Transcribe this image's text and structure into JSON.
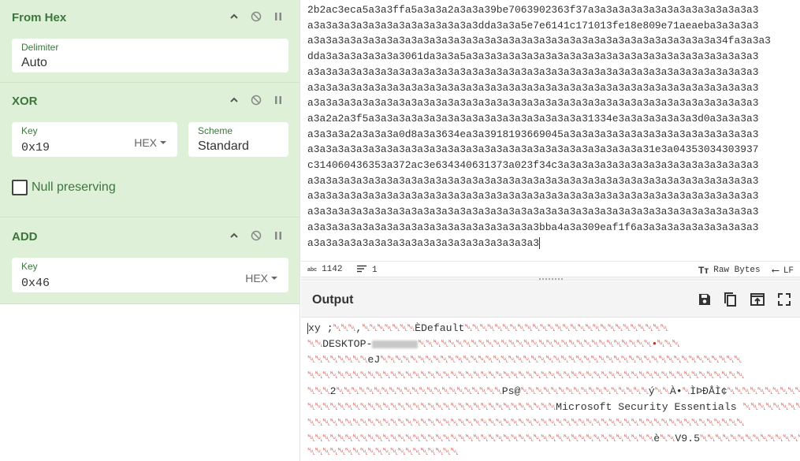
{
  "recipe": {
    "operations": [
      {
        "title": "From Hex",
        "fields": [
          {
            "label": "Delimiter",
            "value": "Auto"
          }
        ]
      },
      {
        "title": "XOR",
        "fields": [
          {
            "label": "Key",
            "value": "0x19",
            "dropdown": "HEX"
          },
          {
            "label": "Scheme",
            "value": "Standard"
          }
        ],
        "checkbox": {
          "label": "Null preserving",
          "checked": false
        }
      },
      {
        "title": "ADD",
        "fields": [
          {
            "label": "Key",
            "value": "0x46",
            "dropdown": "HEX"
          }
        ]
      }
    ],
    "icons": [
      "chevron-up-icon",
      "disable-icon",
      "pause-icon"
    ],
    "colors": {
      "op_bg": "#dff0d8",
      "op_text": "#3c763d"
    }
  },
  "input": {
    "lines": [
      "2b2ac3eca5a3a3ffa5a3a3a2a3a3a39be7063902363f37a3a3a3a3a3a3a3a3a3a3a3a3a3a3",
      "a3a3a3a3a3a3a3a3a3a3a3a3a3a3dda3a3a5e7e6141c171013fe18e809e71aeaeba3a3a3a3",
      "a3a3a3a3a3a3a3a3a3a3a3a3a3a3a3a3a3a3a3a3a3a3a3a3a3a3a3a3a3a3a3a3a3a34fa3a3a3",
      "dda3a3a3a3a3a3a3061da3a3a5a3a3a3a3a3a3a3a3a3a3a3a3a3a3a3a3a3a3a3a3a3a3a3a3",
      "a3a3a3a3a3a3a3a3a3a3a3a3a3a3a3a3a3a3a3a3a3a3a3a3a3a3a3a3a3a3a3a3a3a3a3a3a3",
      "a3a3a3a3a3a3a3a3a3a3a3a3a3a3a3a3a3a3a3a3a3a3a3a3a3a3a3a3a3a3a3a3a3a3a3a3a3",
      "a3a3a3a3a3a3a3a3a3a3a3a3a3a3a3a3a3a3a3a3a3a3a3a3a3a3a3a3a3a3a3a3a3a3a3a3a3",
      "a3a2a2a3f5a3a3a3a3a3a3a3a3a3a3a3a3a3a3a3a3a3a31334e3a3a3a3a3a3a3d0a3a3a3a3",
      "a3a3a3a2a3a3a3a0d8a3a3634ea3a3918193669045a3a3a3a3a3a3a3a3a3a3a3a3a3a3a3a3",
      "a3a3a3a3a3a3a3a3a3a3a3a3a3a3a3a3a3a3a3a3a3a3a3a3a3a3a3a31e3a04353034303937",
      "c314060436353a372ac3e634340631373a023f34c3a3a3a3a3a3a3a3a3a3a3a3a3a3a3a3a3",
      "a3a3a3a3a3a3a3a3a3a3a3a3a3a3a3a3a3a3a3a3a3a3a3a3a3a3a3a3a3a3a3a3a3a3a3a3a3",
      "a3a3a3a3a3a3a3a3a3a3a3a3a3a3a3a3a3a3a3a3a3a3a3a3a3a3a3a3a3a3a3a3a3a3a3a3a3",
      "a3a3a3a3a3a3a3a3a3a3a3a3a3a3a3a3a3a3a3a3a3a3a3a3a3a3a3a3a3a3a3a3a3a3a3a3a3",
      "a3a3a3a3a3a3a3a3a3a3a3a3a3a3a3a3a3a3a3bba4a3a309eaf1f6a3a3a3a3a3a3a3a3a3a3",
      "a3a3a3a3a3a3a3a3a3a3a3a3a3a3a3a3a3a3a3"
    ],
    "status": {
      "length": "1142",
      "lines": "1",
      "raw_bytes": "Raw Bytes",
      "eol": "LF"
    }
  },
  "output": {
    "title": "Output",
    "icons": [
      "save-icon",
      "copy-icon",
      "replace-input-icon",
      "fullscreen-icon"
    ],
    "lines": [
      {
        "pre": "xy ;",
        "ctl1": "␀␀␀",
        "mid": ",",
        "ctl2": "␀␀␀␀␀␀␀",
        "text": "ÈDefault",
        "ctl3": "␀␀␀␀␀␀␀␀␀␀␀␀␀␀␀␀␀␀␀␀␀␀␀␀␀␀␀"
      },
      {
        "pre": "",
        "ctl1": "␀␀",
        "mid": "DESKTOP-",
        "ctl2": "",
        "text": "",
        "ctl3": "␀␀␀␀␀␀␀␀␀␀␀␀␀␀␀␀␀␀␀␀␀␀␀␀␀␀␀␀␀␀␀•␀␀␀"
      },
      {
        "pre": "",
        "ctl1": "␀␀␀␀␀␀␀␀",
        "mid": "eJ",
        "ctl2": "␀␀␀␀␀␀␀␀␀␀␀␀␀␀␀␀␀␀␀␀␀␀␀␀␀␀␀␀␀␀␀␀␀␀␀␀␀␀␀␀␀␀␀␀␀␀␀␀",
        "text": "",
        "ctl3": ""
      },
      {
        "pre": "",
        "ctl1": "␀␀␀␀␀␀␀␀␀␀␀␀␀␀␀␀␀␀␀␀␀␀␀␀␀␀␀␀␀␀␀␀␀␀␀␀␀␀␀␀␀␀␀␀␀␀␀␀␀␀␀␀␀␀␀␀␀␀",
        "mid": "",
        "ctl2": "",
        "text": "",
        "ctl3": ""
      },
      {
        "pre": "",
        "ctl1": "␀␀␀",
        "mid": "2",
        "ctl2": "␀␀␀␀␀␀␀␀␀␀␀␀␀␀␀␀␀␀␀␀␀␀",
        "text": "Ps@",
        "ctl3": "␀␀␀␀␀␀␀␀␀␀␀␀␀␀␀␀␀",
        "tail": "ý",
        "ctl4": "␀␀",
        "tail2": "À•",
        "ctl5": "␀",
        "tail3": "ÌÞÐÅÌ¢",
        "ctl6": "␀␀␀␀␀␀␀␀␀␀␀␀␀␀␀␀␀␀␀"
      },
      {
        "pre": "",
        "ctl1": "␀␀␀␀␀␀␀␀␀␀␀␀␀␀␀␀␀␀␀␀␀␀␀␀␀␀␀␀␀␀␀␀␀",
        "mid": "",
        "ctl2": "",
        "text": "Microsoft Security Essentials ",
        "ctl3": "␀␀␀␀␀␀␀␀␀␀␀␀␀␀␀␀"
      },
      {
        "pre": "",
        "ctl1": "␀␀␀␀␀␀␀␀␀␀␀␀␀␀␀␀␀␀␀␀␀␀␀␀␀␀␀␀␀␀␀␀␀␀␀␀␀␀␀␀␀␀␀␀␀␀␀␀␀␀␀␀␀␀␀␀␀␀",
        "mid": "",
        "ctl2": "",
        "text": "",
        "ctl3": ""
      },
      {
        "pre": "",
        "ctl1": "␀␀␀␀␀␀␀␀␀␀␀␀␀␀␀␀␀␀␀␀␀␀␀␀␀␀␀␀␀␀␀␀␀␀␀␀␀␀␀␀␀␀␀␀␀␀",
        "mid": "è",
        "ctl2": "␀␀",
        "text": "V9.5",
        "ctl3": "␀␀␀␀␀␀␀␀␀␀␀␀␀␀␀␀␀␀␀␀␀␀␀␀␀"
      },
      {
        "pre": "",
        "ctl1": "␀␀␀␀␀␀␀␀␀␀␀␀␀␀␀␀␀␀␀␀",
        "mid": "",
        "ctl2": "",
        "text": "",
        "ctl3": ""
      }
    ]
  }
}
